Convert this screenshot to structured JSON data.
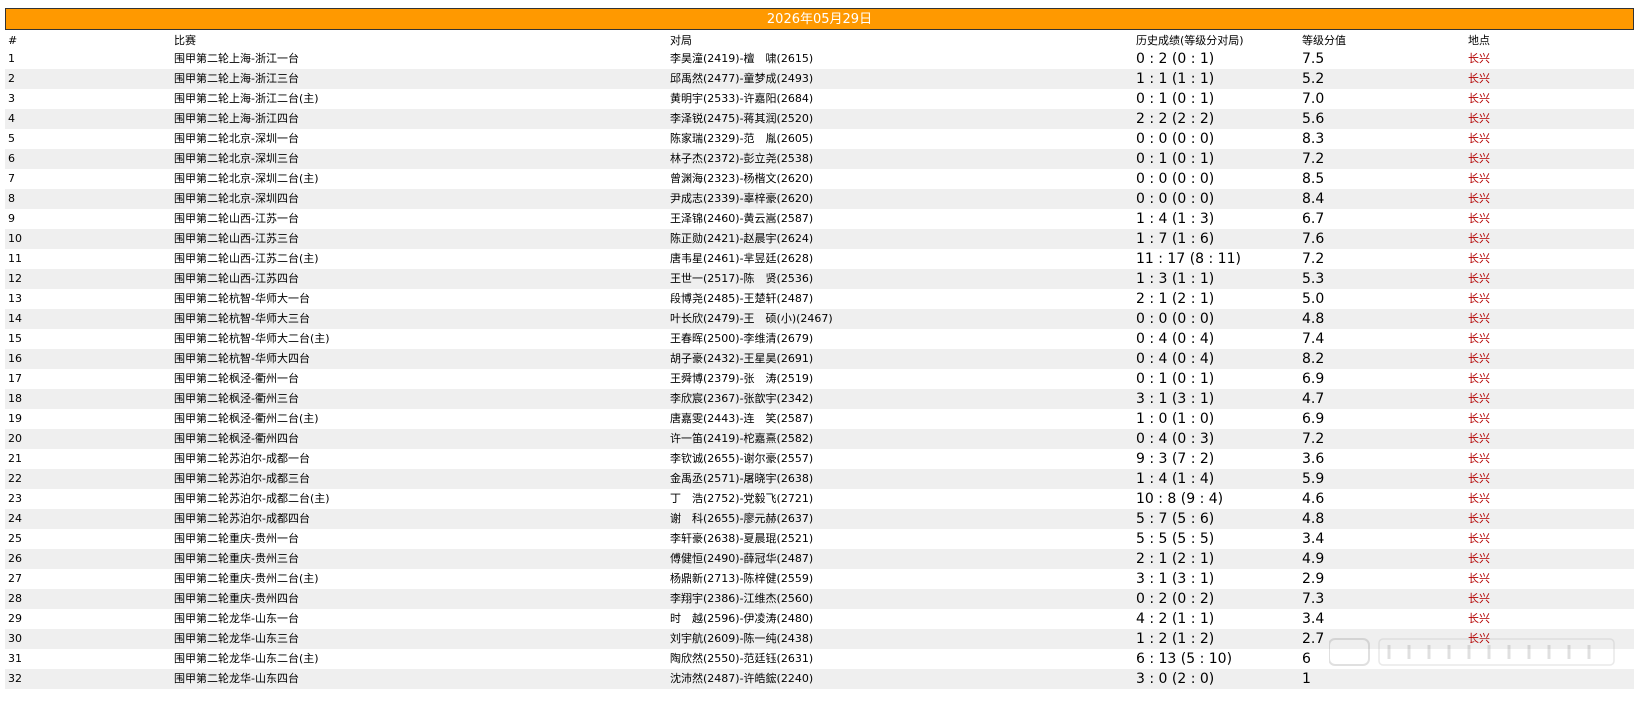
{
  "date_label": "2026年05月29日",
  "headers": [
    "#",
    "比赛",
    "对局",
    "历史成绩(等级分对局)",
    "等级分值",
    "地点"
  ],
  "rows": [
    [
      "1",
      "围甲第二轮上海-浙江一台",
      "李昊潼(2419)-檀　啸(2615)",
      "0 : 2 (0 : 1)",
      "7.5",
      "长兴"
    ],
    [
      "2",
      "围甲第二轮上海-浙江三台",
      "邱禹然(2477)-童梦成(2493)",
      "1 : 1 (1 : 1)",
      "5.2",
      "长兴"
    ],
    [
      "3",
      "围甲第二轮上海-浙江二台(主)",
      "黄明宇(2533)-许嘉阳(2684)",
      "0 : 1 (0 : 1)",
      "7.0",
      "长兴"
    ],
    [
      "4",
      "围甲第二轮上海-浙江四台",
      "李泽锐(2475)-蒋其润(2520)",
      "2 : 2 (2 : 2)",
      "5.6",
      "长兴"
    ],
    [
      "5",
      "围甲第二轮北京-深圳一台",
      "陈家瑞(2329)-范　胤(2605)",
      "0 : 0 (0 : 0)",
      "8.3",
      "长兴"
    ],
    [
      "6",
      "围甲第二轮北京-深圳三台",
      "林子杰(2372)-彭立尧(2538)",
      "0 : 1 (0 : 1)",
      "7.2",
      "长兴"
    ],
    [
      "7",
      "围甲第二轮北京-深圳二台(主)",
      "曾渊海(2323)-杨楷文(2620)",
      "0 : 0 (0 : 0)",
      "8.5",
      "长兴"
    ],
    [
      "8",
      "围甲第二轮北京-深圳四台",
      "尹成志(2339)-辜梓豪(2620)",
      "0 : 0 (0 : 0)",
      "8.4",
      "长兴"
    ],
    [
      "9",
      "围甲第二轮山西-江苏一台",
      "王泽锦(2460)-黄云嵩(2587)",
      "1 : 4 (1 : 3)",
      "6.7",
      "长兴"
    ],
    [
      "10",
      "围甲第二轮山西-江苏三台",
      "陈正勋(2421)-赵晨宇(2624)",
      "1 : 7 (1 : 6)",
      "7.6",
      "长兴"
    ],
    [
      "11",
      "围甲第二轮山西-江苏二台(主)",
      "唐韦星(2461)-芈昱廷(2628)",
      "11 : 17 (8 : 11)",
      "7.2",
      "长兴"
    ],
    [
      "12",
      "围甲第二轮山西-江苏四台",
      "王世一(2517)-陈　贤(2536)",
      "1 : 3 (1 : 1)",
      "5.3",
      "长兴"
    ],
    [
      "13",
      "围甲第二轮杭智-华师大一台",
      "段博尧(2485)-王楚轩(2487)",
      "2 : 1 (2 : 1)",
      "5.0",
      "长兴"
    ],
    [
      "14",
      "围甲第二轮杭智-华师大三台",
      "叶长欣(2479)-王　硕(小)(2467)",
      "0 : 0 (0 : 0)",
      "4.8",
      "长兴"
    ],
    [
      "15",
      "围甲第二轮杭智-华师大二台(主)",
      "王春晖(2500)-李维清(2679)",
      "0 : 4 (0 : 4)",
      "7.4",
      "长兴"
    ],
    [
      "16",
      "围甲第二轮杭智-华师大四台",
      "胡子豪(2432)-王星昊(2691)",
      "0 : 4 (0 : 4)",
      "8.2",
      "长兴"
    ],
    [
      "17",
      "围甲第二轮枫泾-衢州一台",
      "王舜博(2379)-张　涛(2519)",
      "0 : 1 (0 : 1)",
      "6.9",
      "长兴"
    ],
    [
      "18",
      "围甲第二轮枫泾-衢州三台",
      "李欣宸(2367)-张歆宇(2342)",
      "3 : 1 (3 : 1)",
      "4.7",
      "长兴"
    ],
    [
      "19",
      "围甲第二轮枫泾-衢州二台(主)",
      "唐嘉雯(2443)-连　笑(2587)",
      "1 : 0 (1 : 0)",
      "6.9",
      "长兴"
    ],
    [
      "20",
      "围甲第二轮枫泾-衢州四台",
      "许一笛(2419)-柁嘉熹(2582)",
      "0 : 4 (0 : 3)",
      "7.2",
      "长兴"
    ],
    [
      "21",
      "围甲第二轮苏泊尔-成都一台",
      "李钦诚(2655)-谢尔豪(2557)",
      "9 : 3 (7 : 2)",
      "3.6",
      "长兴"
    ],
    [
      "22",
      "围甲第二轮苏泊尔-成都三台",
      "金禹丞(2571)-屠晓宇(2638)",
      "1 : 4 (1 : 4)",
      "5.9",
      "长兴"
    ],
    [
      "23",
      "围甲第二轮苏泊尔-成都二台(主)",
      "丁　浩(2752)-党毅飞(2721)",
      "10 : 8 (9 : 4)",
      "4.6",
      "长兴"
    ],
    [
      "24",
      "围甲第二轮苏泊尔-成都四台",
      "谢　科(2655)-廖元赫(2637)",
      "5 : 7 (5 : 6)",
      "4.8",
      "长兴"
    ],
    [
      "25",
      "围甲第二轮重庆-贵州一台",
      "李轩豪(2638)-夏晨琨(2521)",
      "5 : 5 (5 : 5)",
      "3.4",
      "长兴"
    ],
    [
      "26",
      "围甲第二轮重庆-贵州三台",
      "傅健恒(2490)-薛冠华(2487)",
      "2 : 1 (2 : 1)",
      "4.9",
      "长兴"
    ],
    [
      "27",
      "围甲第二轮重庆-贵州二台(主)",
      "杨鼎新(2713)-陈梓健(2559)",
      "3 : 1 (3 : 1)",
      "2.9",
      "长兴"
    ],
    [
      "28",
      "围甲第二轮重庆-贵州四台",
      "李翔宇(2386)-江维杰(2560)",
      "0 : 2 (0 : 2)",
      "7.3",
      "长兴"
    ],
    [
      "29",
      "围甲第二轮龙华-山东一台",
      "时　越(2596)-伊凌涛(2480)",
      "4 : 2 (1 : 1)",
      "3.4",
      "长兴"
    ],
    [
      "30",
      "围甲第二轮龙华-山东三台",
      "刘宇航(2609)-陈一纯(2438)",
      "1 : 2 (1 : 2)",
      "2.7",
      "长兴"
    ],
    [
      "31",
      "围甲第二轮龙华-山东二台(主)",
      "陶欣然(2550)-范廷钰(2631)",
      "6 : 13 (5 : 10)",
      "6",
      ""
    ],
    [
      "32",
      "围甲第二轮龙华-山东四台",
      "沈沛然(2487)-许皓鋐(2240)",
      "3 : 0 (2 : 0)",
      "1",
      ""
    ]
  ]
}
